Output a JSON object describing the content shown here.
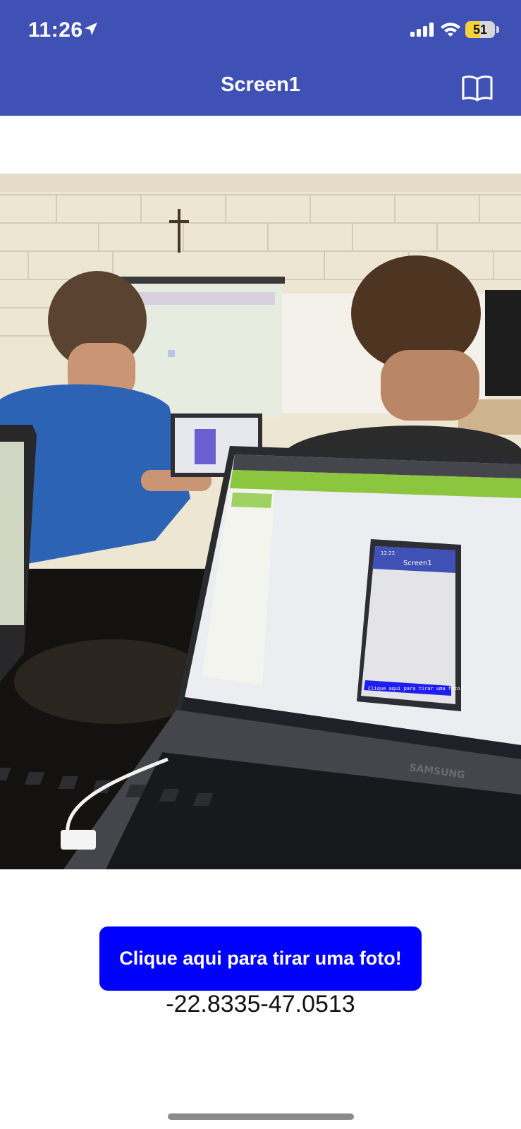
{
  "status_bar": {
    "time": "11:26",
    "battery_level": "51",
    "battery_fraction": 0.51
  },
  "header": {
    "title": "Screen1",
    "background": "#3f51b5"
  },
  "photo": {
    "laptop_screen": {
      "app_title": "Screen1",
      "phone_time": "12:22",
      "button_label": "Clique aqui para tirar uma foto!",
      "brand": "SAMSUNG"
    }
  },
  "main": {
    "button_label": "Clique aqui para tirar uma foto!",
    "button_color": "#0000ff",
    "location_text": "-22.8335-47.0513"
  },
  "icons": {
    "status": [
      "location-arrow-icon",
      "signal-icon",
      "wifi-icon",
      "battery-icon"
    ],
    "header": "book-icon"
  }
}
